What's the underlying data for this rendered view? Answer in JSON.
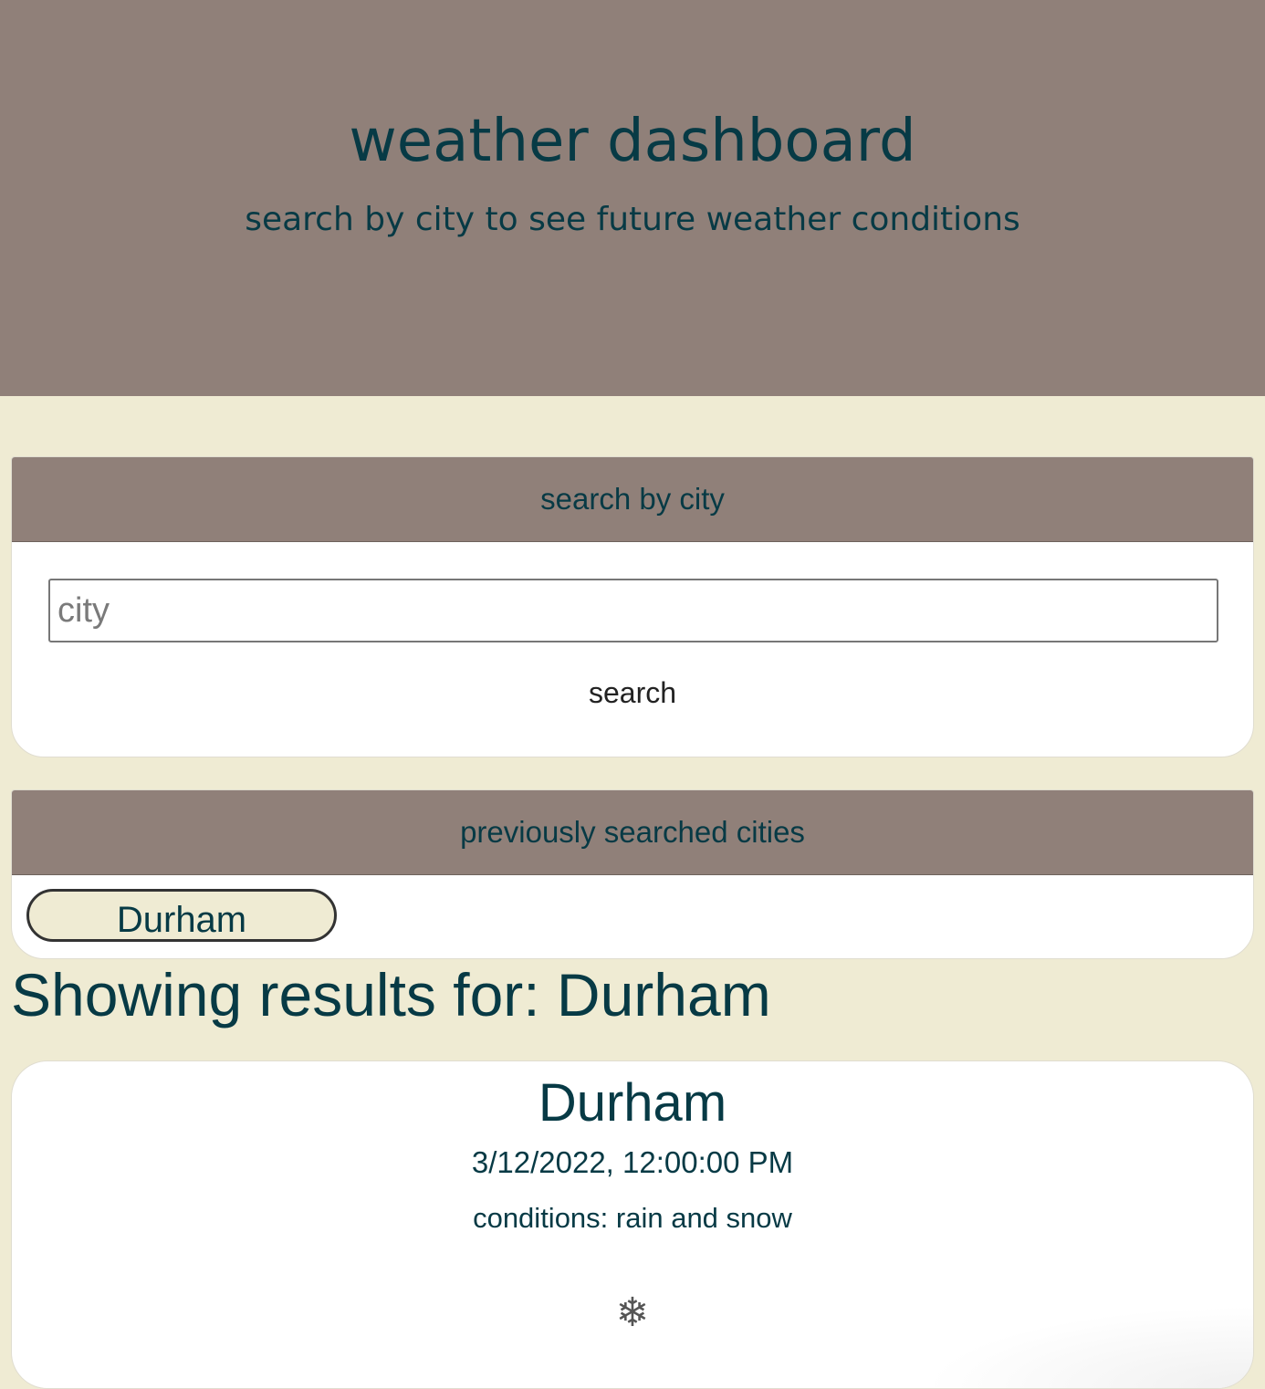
{
  "header": {
    "title": "weather dashboard",
    "subtitle": "search by city to see future weather conditions"
  },
  "search": {
    "header": "search by city",
    "placeholder": "city",
    "value": "",
    "button_label": "search"
  },
  "history": {
    "header": "previously searched cities",
    "items": [
      {
        "label": "Durham"
      }
    ]
  },
  "results": {
    "heading": "Showing results for: Durham"
  },
  "forecast": {
    "city": "Durham",
    "datetime": "3/12/2022, 12:00:00 PM",
    "conditions": "conditions: rain and snow",
    "icon_name": "snowflake-icon",
    "icon_glyph": "❄"
  },
  "colors": {
    "background": "#efebd3",
    "header_bg": "#908079",
    "text": "#073a45",
    "card_bg": "#ffffff"
  }
}
